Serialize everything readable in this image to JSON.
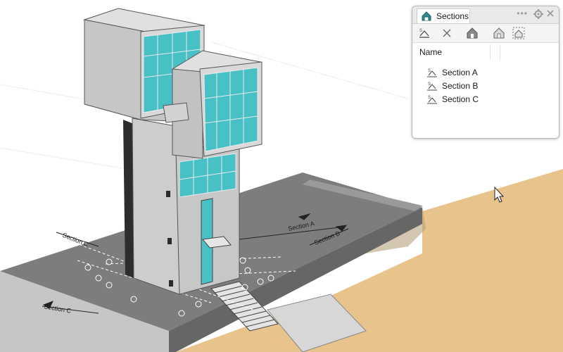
{
  "viewport": {
    "section_labels": [
      "Section A",
      "Section B",
      "Section C"
    ]
  },
  "panel": {
    "tab_title": "Sections",
    "toolbar_buttons": [
      "new-section-icon",
      "delete-icon",
      "section-house-filled-icon",
      "section-house-outline-icon",
      "section-house-dashed-icon"
    ],
    "column_header": "Name",
    "items": [
      {
        "label": "Section A"
      },
      {
        "label": "Section B"
      },
      {
        "label": "Section C"
      }
    ]
  },
  "colors": {
    "accent_teal": "#47c0c6",
    "concrete": "#c9c9c9",
    "ground": "#7a7a7a",
    "sand": "#e7c48d"
  }
}
